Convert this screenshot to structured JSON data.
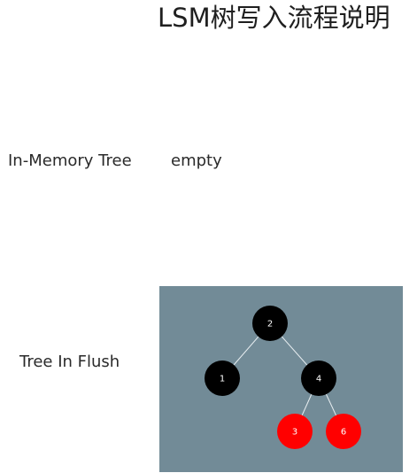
{
  "page": {
    "title": "LSM树写入流程说明"
  },
  "in_memory": {
    "label": "In-Memory Tree",
    "value": "empty"
  },
  "flush": {
    "label": "Tree In Flush",
    "panel_color": "#728b97",
    "edge_color": "#e8eef1",
    "tree": {
      "root": "2",
      "nodes": [
        {
          "key": "2",
          "color": "black",
          "fill": "#000000",
          "text_color": "#ffffff"
        },
        {
          "key": "1",
          "color": "black",
          "fill": "#000000",
          "text_color": "#ffffff"
        },
        {
          "key": "4",
          "color": "black",
          "fill": "#000000",
          "text_color": "#ffffff"
        },
        {
          "key": "3",
          "color": "red",
          "fill": "#ff0000",
          "text_color": "#ffffff"
        },
        {
          "key": "6",
          "color": "red",
          "fill": "#ff0000",
          "text_color": "#ffffff"
        }
      ],
      "edges": [
        {
          "from": "2",
          "to": "1"
        },
        {
          "from": "2",
          "to": "4"
        },
        {
          "from": "4",
          "to": "3"
        },
        {
          "from": "4",
          "to": "6"
        }
      ]
    }
  }
}
